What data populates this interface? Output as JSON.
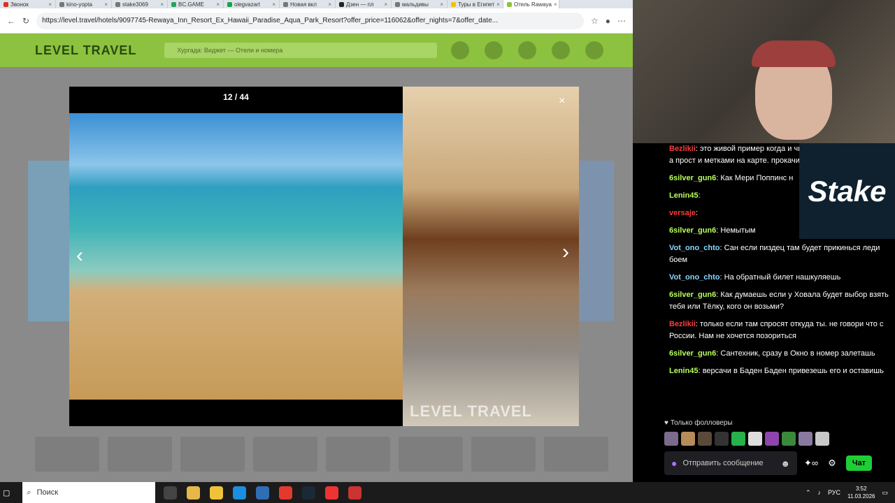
{
  "browser": {
    "tabs": [
      {
        "label": "Звонок",
        "color": "#d93025"
      },
      {
        "label": "kino-yopta",
        "color": "#777777"
      },
      {
        "label": "stake3069",
        "color": "#777777"
      },
      {
        "label": "BC.GAME",
        "color": "#24a65b"
      },
      {
        "label": "olegvazart",
        "color": "#19a34a"
      },
      {
        "label": "Новая вкл",
        "color": "#777777"
      },
      {
        "label": "Дзен — пл",
        "color": "#222222"
      },
      {
        "label": "мальдивы",
        "color": "#777777"
      },
      {
        "label": "Туры в Египет",
        "color": "#f2c200"
      },
      {
        "label": "Отель Rawaya",
        "color": "#8cc23f"
      }
    ],
    "url": "https://level.travel/hotels/9097745-Rewaya_Inn_Resort_Ex_Hawaii_Paradise_Aqua_Park_Resort?offer_price=116062&offer_nights=7&offer_date..."
  },
  "site": {
    "logo": "LEVEL TRAVEL",
    "search_placeholder": "Хургада: Виджет — Отели и номера"
  },
  "gallery": {
    "counter": "12 / 44",
    "watermark": "LEVEL TRAVEL",
    "close_glyph": "×",
    "prev_glyph": "‹",
    "next_glyph": "›"
  },
  "chat": {
    "messages": [
      {
        "nick": "Bezlikii",
        "color": "#ff3b3b",
        "text": "это живой пример когда и читаешь что говорят NPC , а прост и метками на карте. прокачиваетс"
      },
      {
        "nick": "6silver_gun6",
        "color": "#b8ff5c",
        "text": "Как Мери Поппинс н"
      },
      {
        "nick": "Lenin45",
        "color": "#b8ff5c",
        "text": ""
      },
      {
        "nick": "versaje",
        "color": "#ff3b3b",
        "text": ""
      },
      {
        "nick": "6silver_gun6",
        "color": "#b8ff5c",
        "text": "Немытым"
      },
      {
        "nick": "Vot_ono_chto",
        "color": "#8ad8ff",
        "text": "Сан если пиздец там будет прикинься леди боем"
      },
      {
        "nick": "Vot_ono_chto",
        "color": "#8ad8ff",
        "text": "На обратный билет нашкуляешь"
      },
      {
        "nick": "6silver_gun6",
        "color": "#b8ff5c",
        "text": "Как думаешь если у Ховала будет выбор взять тебя или Тёлку, кого он возьми?"
      },
      {
        "nick": "Bezlikii",
        "color": "#ff3b3b",
        "text": "только если там спросят откуда ты. не говори что с России. Нам не хочется позориться"
      },
      {
        "nick": "6silver_gun6",
        "color": "#b8ff5c",
        "text": "Сантехник, сразу в Окно в номер залеташь"
      },
      {
        "nick": "Lenin45",
        "color": "#b8ff5c",
        "text": "версачи в Баден Баден привезешь его и оставишь"
      }
    ],
    "followers_only": "♥ Только фолловеры",
    "input_placeholder": "Отправить сообщение",
    "chat_button": "Чат"
  },
  "stake_logo": "Stake",
  "taskbar": {
    "search_label": "Поиск",
    "lang": "РУС",
    "time": "3:52",
    "date": "11.03.2026"
  }
}
